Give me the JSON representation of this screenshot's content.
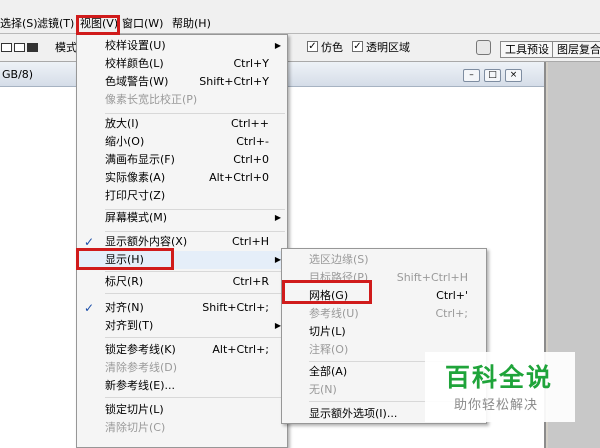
{
  "menubar": {
    "items": [
      "选择(S)",
      "滤镜(T)",
      "视图(V)",
      "窗口(W)",
      "帮助(H)"
    ]
  },
  "toolbar": {
    "mode_label": "模式",
    "checkbox_antialias": "仿色",
    "checkbox_transparent": "透明区域",
    "tab_tool_presets": "工具预设",
    "tab_layer_comps": "图层复合"
  },
  "document": {
    "title": "GB/8)"
  },
  "view_menu": {
    "items": [
      {
        "label": "校样设置(U)",
        "shortcut": "",
        "submenu": true,
        "disabled": false,
        "checked": false
      },
      {
        "label": "校样颜色(L)",
        "shortcut": "Ctrl+Y",
        "submenu": false,
        "disabled": false,
        "checked": false
      },
      {
        "label": "色域警告(W)",
        "shortcut": "Shift+Ctrl+Y",
        "submenu": false,
        "disabled": false,
        "checked": false
      },
      {
        "label": "像素长宽比校正(P)",
        "shortcut": "",
        "submenu": false,
        "disabled": true,
        "checked": false
      },
      {
        "label": "放大(I)",
        "shortcut": "Ctrl++",
        "submenu": false,
        "disabled": false,
        "checked": false
      },
      {
        "label": "缩小(O)",
        "shortcut": "Ctrl+-",
        "submenu": false,
        "disabled": false,
        "checked": false
      },
      {
        "label": "满画布显示(F)",
        "shortcut": "Ctrl+0",
        "submenu": false,
        "disabled": false,
        "checked": false
      },
      {
        "label": "实际像素(A)",
        "shortcut": "Alt+Ctrl+0",
        "submenu": false,
        "disabled": false,
        "checked": false
      },
      {
        "label": "打印尺寸(Z)",
        "shortcut": "",
        "submenu": false,
        "disabled": false,
        "checked": false
      },
      {
        "label": "屏幕模式(M)",
        "shortcut": "",
        "submenu": true,
        "disabled": false,
        "checked": false
      },
      {
        "label": "显示额外内容(X)",
        "shortcut": "Ctrl+H",
        "submenu": false,
        "disabled": false,
        "checked": true
      },
      {
        "label": "显示(H)",
        "shortcut": "",
        "submenu": true,
        "disabled": false,
        "checked": false
      },
      {
        "label": "标尺(R)",
        "shortcut": "Ctrl+R",
        "submenu": false,
        "disabled": false,
        "checked": false
      },
      {
        "label": "对齐(N)",
        "shortcut": "Shift+Ctrl+;",
        "submenu": false,
        "disabled": false,
        "checked": true
      },
      {
        "label": "对齐到(T)",
        "shortcut": "",
        "submenu": true,
        "disabled": false,
        "checked": false
      },
      {
        "label": "锁定参考线(K)",
        "shortcut": "Alt+Ctrl+;",
        "submenu": false,
        "disabled": false,
        "checked": false
      },
      {
        "label": "清除参考线(D)",
        "shortcut": "",
        "submenu": false,
        "disabled": true,
        "checked": false
      },
      {
        "label": "新参考线(E)...",
        "shortcut": "",
        "submenu": false,
        "disabled": false,
        "checked": false
      },
      {
        "label": "锁定切片(L)",
        "shortcut": "",
        "submenu": false,
        "disabled": false,
        "checked": false
      },
      {
        "label": "清除切片(C)",
        "shortcut": "",
        "submenu": false,
        "disabled": true,
        "checked": false
      }
    ]
  },
  "show_submenu": {
    "items": [
      {
        "label": "选区边缘(S)",
        "shortcut": "",
        "disabled": true
      },
      {
        "label": "目标路径(P)",
        "shortcut": "Shift+Ctrl+H",
        "disabled": true
      },
      {
        "label": "网格(G)",
        "shortcut": "Ctrl+'",
        "disabled": false
      },
      {
        "label": "参考线(U)",
        "shortcut": "Ctrl+;",
        "disabled": true
      },
      {
        "label": "切片(L)",
        "shortcut": "",
        "disabled": false
      },
      {
        "label": "注释(O)",
        "shortcut": "",
        "disabled": true
      },
      {
        "label": "全部(A)",
        "shortcut": "",
        "disabled": false
      },
      {
        "label": "无(N)",
        "shortcut": "",
        "disabled": true
      },
      {
        "label": "显示额外选项(I)...",
        "shortcut": "",
        "disabled": false
      }
    ]
  },
  "watermark": {
    "title": "百科全说",
    "subtitle": "助你轻松解决"
  },
  "colors": {
    "highlight_red": "#d01b1b",
    "check_blue": "#1c4fa8",
    "watermark_green": "#1fa43a"
  }
}
